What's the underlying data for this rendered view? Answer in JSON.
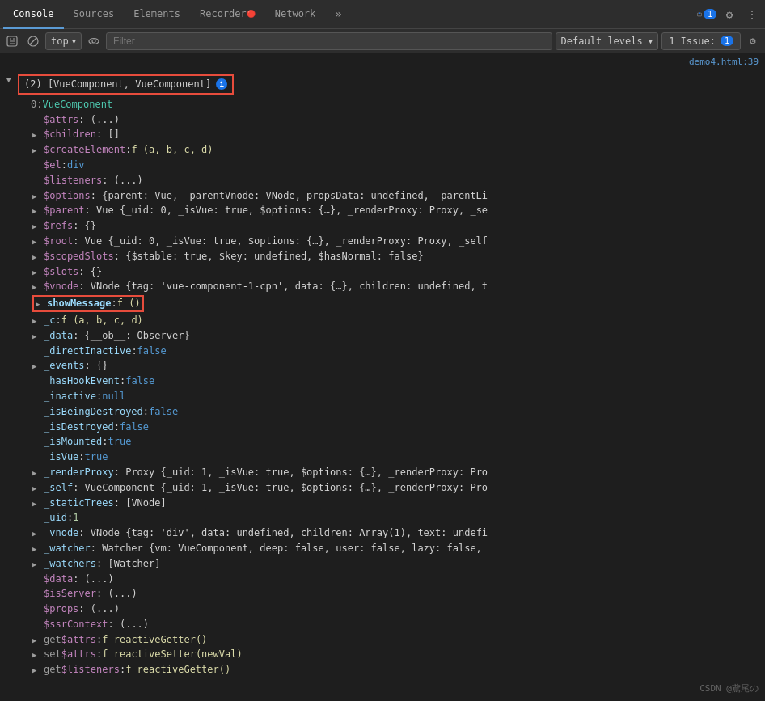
{
  "tabs": [
    {
      "id": "console",
      "label": "Console",
      "active": true
    },
    {
      "id": "sources",
      "label": "Sources",
      "active": false
    },
    {
      "id": "elements",
      "label": "Elements",
      "active": false
    },
    {
      "id": "recorder",
      "label": "Recorder 🔴",
      "active": false
    },
    {
      "id": "network",
      "label": "Network",
      "active": false
    }
  ],
  "toolbar": {
    "more_tabs_icon": "»",
    "notification_count": "1",
    "settings_icon": "⚙",
    "more_icon": "⋮",
    "panel_icon": "⊞"
  },
  "secondary_toolbar": {
    "execute_icon": "▷",
    "clear_icon": "🚫",
    "context_label": "top",
    "eye_icon": "👁",
    "filter_placeholder": "Filter",
    "levels_label": "Default levels",
    "issue_label": "1 Issue:",
    "issue_count": "1",
    "settings_icon": "⚙"
  },
  "console": {
    "source_link": "demo4.html:39",
    "root_label": "▼ (2) [VueComponent, VueComponent]",
    "info_icon": "i",
    "items": [
      {
        "indent": 1,
        "arrow": "none",
        "text": "0: VueComponent"
      },
      {
        "indent": 2,
        "arrow": "none",
        "text": "$attrs: (...)"
      },
      {
        "indent": 2,
        "arrow": "right",
        "text": "$children: []"
      },
      {
        "indent": 2,
        "arrow": "right",
        "text": "$createElement: f (a, b, c, d)"
      },
      {
        "indent": 2,
        "arrow": "none",
        "text": "$el: div"
      },
      {
        "indent": 2,
        "arrow": "none",
        "text": "$listeners: (...)"
      },
      {
        "indent": 2,
        "arrow": "right",
        "text": "$options: {parent: Vue, _parentVnode: VNode, propsData: undefined, _parentLi"
      },
      {
        "indent": 2,
        "arrow": "right",
        "text": "$parent: Vue {_uid: 0, _isVue: true, $options: {…}, _renderProxy: Proxy, _se"
      },
      {
        "indent": 2,
        "arrow": "right",
        "text": "$refs: {}"
      },
      {
        "indent": 2,
        "arrow": "right",
        "text": "$root: Vue {_uid: 0, _isVue: true, $options: {…}, _renderProxy: Proxy, _self"
      },
      {
        "indent": 2,
        "arrow": "right",
        "text": "$scopedSlots: {$stable: true, $key: undefined, $hasNormal: false}"
      },
      {
        "indent": 2,
        "arrow": "right",
        "text": "$slots: {}"
      },
      {
        "indent": 2,
        "arrow": "right",
        "text": "$vnode: VNode {tag: 'vue-component-1-cpn', data: {…}, children: undefined, t"
      },
      {
        "indent": 2,
        "arrow": "right",
        "text": "showMessage: f ()",
        "highlight": true
      },
      {
        "indent": 2,
        "arrow": "right",
        "text": "_c: f (a, b, c, d)"
      },
      {
        "indent": 2,
        "arrow": "right",
        "text": "_data: {__ob__: Observer}"
      },
      {
        "indent": 2,
        "arrow": "none",
        "text": "_directInactive: false"
      },
      {
        "indent": 2,
        "arrow": "right",
        "text": "_events: {}"
      },
      {
        "indent": 2,
        "arrow": "none",
        "text": "_hasHookEvent: false"
      },
      {
        "indent": 2,
        "arrow": "none",
        "text": "_inactive: null"
      },
      {
        "indent": 2,
        "arrow": "none",
        "text": "_isBeingDestroyed: false"
      },
      {
        "indent": 2,
        "arrow": "none",
        "text": "_isDestroyed: false"
      },
      {
        "indent": 2,
        "arrow": "none",
        "text": "_isMounted: true"
      },
      {
        "indent": 2,
        "arrow": "none",
        "text": "_isVue: true"
      },
      {
        "indent": 2,
        "arrow": "right",
        "text": "_renderProxy: Proxy {_uid: 1, _isVue: true, $options: {…}, _renderProxy: Pro"
      },
      {
        "indent": 2,
        "arrow": "right",
        "text": "_self: VueComponent {_uid: 1, _isVue: true, $options: {…}, _renderProxy: Pro"
      },
      {
        "indent": 2,
        "arrow": "right",
        "text": "_staticTrees: [VNode]"
      },
      {
        "indent": 2,
        "arrow": "none",
        "text": "_uid: 1"
      },
      {
        "indent": 2,
        "arrow": "right",
        "text": "_vnode: VNode {tag: 'div', data: undefined, children: Array(1), text: undefi"
      },
      {
        "indent": 2,
        "arrow": "right",
        "text": "_watcher: Watcher {vm: VueComponent, deep: false, user: false, lazy: false,"
      },
      {
        "indent": 2,
        "arrow": "right",
        "text": "_watchers: [Watcher]"
      },
      {
        "indent": 2,
        "arrow": "none",
        "text": "$data: (...)"
      },
      {
        "indent": 2,
        "arrow": "none",
        "text": "$isServer: (...)"
      },
      {
        "indent": 2,
        "arrow": "none",
        "text": "$props: (...)"
      },
      {
        "indent": 2,
        "arrow": "none",
        "text": "$ssrContext: (...)"
      },
      {
        "indent": 2,
        "arrow": "right",
        "text": "get $attrs: f reactiveGetter()"
      },
      {
        "indent": 2,
        "arrow": "right",
        "text": "set $attrs: f reactiveSetter(newVal)"
      },
      {
        "indent": 2,
        "arrow": "right",
        "text": "get $listeners: f reactiveGetter()"
      }
    ]
  },
  "watermark": "CSDN @鳶尾の"
}
